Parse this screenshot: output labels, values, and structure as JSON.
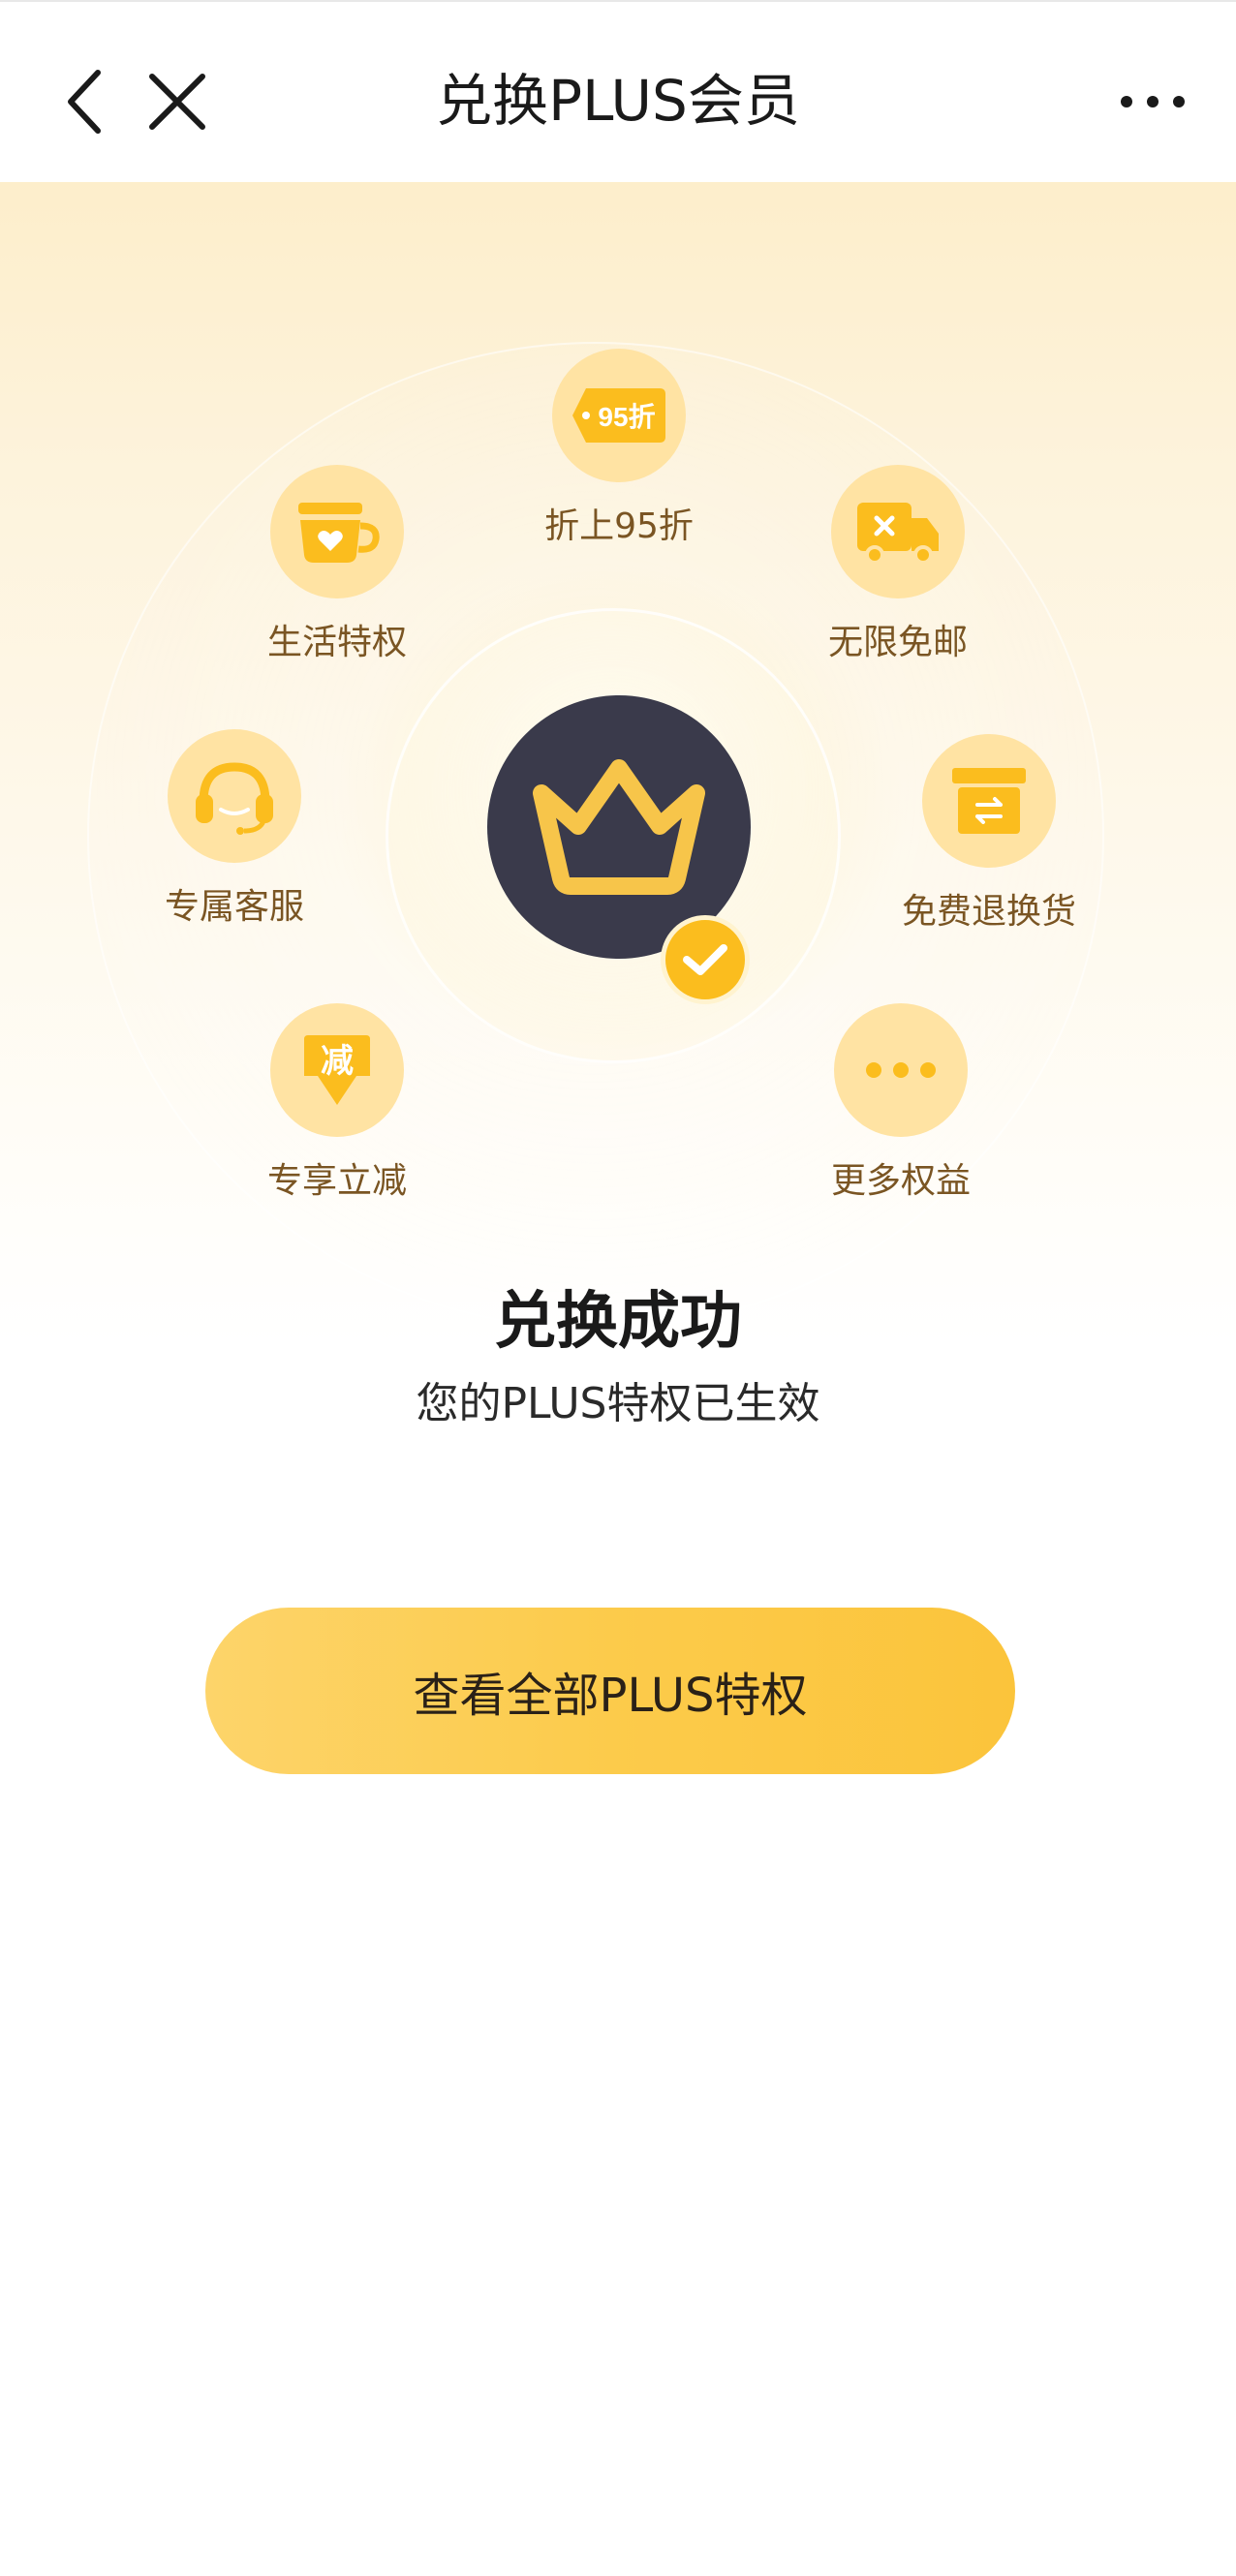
{
  "header": {
    "title": "兑换PLUS会员"
  },
  "hero": {
    "benefits": [
      {
        "id": "discount",
        "label": "折上95折",
        "badge_text": "95折",
        "icon": "discount-tag-icon"
      },
      {
        "id": "life",
        "label": "生活特权",
        "icon": "cup-heart-icon"
      },
      {
        "id": "shipping",
        "label": "无限免邮",
        "icon": "delivery-truck-icon"
      },
      {
        "id": "service",
        "label": "专属客服",
        "icon": "headset-icon"
      },
      {
        "id": "return",
        "label": "免费退换货",
        "icon": "return-box-icon"
      },
      {
        "id": "reduce",
        "label": "专享立减",
        "badge_text": "减",
        "icon": "reduction-arrow-icon"
      },
      {
        "id": "more",
        "label": "更多权益",
        "icon": "more-dots-icon"
      }
    ]
  },
  "result": {
    "title": "兑换成功",
    "subtitle": "您的PLUS特权已生效"
  },
  "cta": {
    "label": "查看全部PLUS特权"
  },
  "colors": {
    "accent": "#fbbd1e",
    "badge_dark": "#3a3a4b",
    "benefit_bg": "#ffe3a3",
    "benefit_text": "#7a5523"
  }
}
